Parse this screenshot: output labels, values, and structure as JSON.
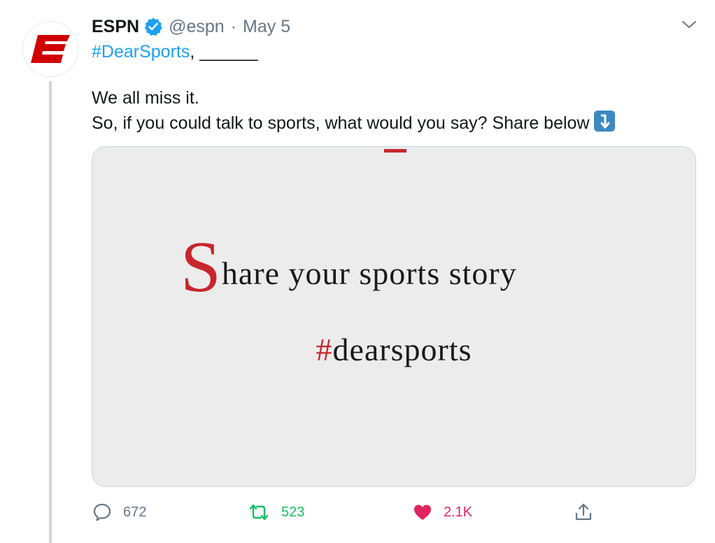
{
  "tweet": {
    "author_name": "ESPN",
    "handle": "@espn",
    "separator": "·",
    "date": "May 5",
    "hashtag": "#DearSports",
    "first_line_rest": ", ______",
    "body_line1": "We all miss it.",
    "body_line2": "So, if you could talk to sports, what would you say? Share below",
    "media": {
      "big_letter": "S",
      "headline_rest": "hare your sports story",
      "hashtag_symbol": "#",
      "hashtag_text": "dearsports"
    },
    "actions": {
      "reply_count": "672",
      "retweet_count": "523",
      "like_count": "2.1K"
    }
  },
  "icons": {
    "avatar": "espn-logo-icon",
    "verified": "verified-badge-icon",
    "menu": "chevron-down-icon",
    "emoji": "arrow-down-right-emoji-icon",
    "reply": "reply-bubble-icon",
    "retweet": "retweet-icon",
    "like": "heart-icon",
    "share": "share-upload-icon"
  },
  "colors": {
    "link": "#1da1f2",
    "muted": "#657786",
    "retweet": "#17bf63",
    "like": "#e0245e",
    "espn_red": "#d00000",
    "media_red": "#c8262d"
  }
}
